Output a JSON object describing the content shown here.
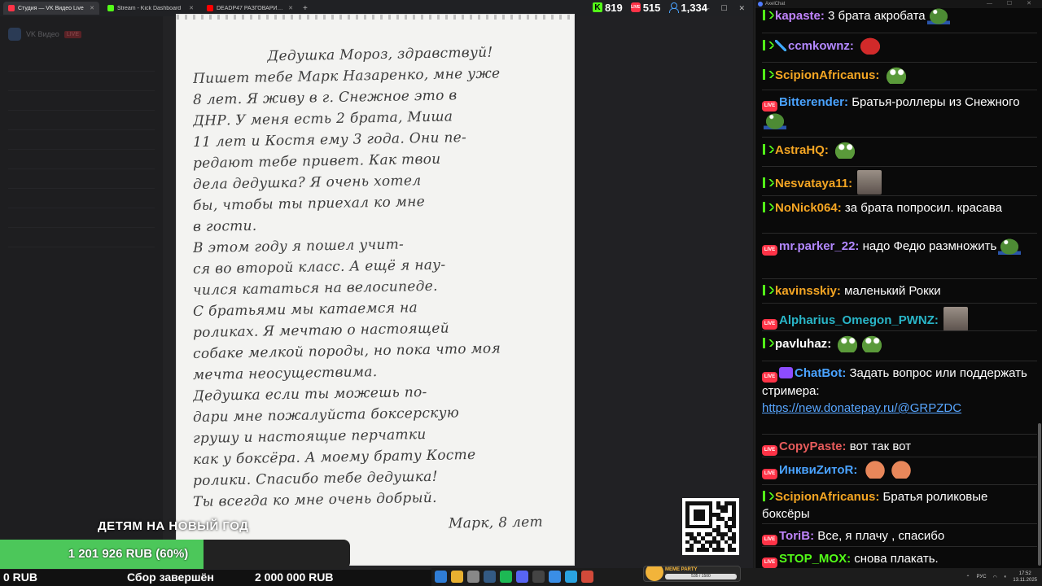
{
  "browser": {
    "tabs": [
      {
        "title": "Студия — VK Видео Live",
        "color": "#ff3347",
        "active": true
      },
      {
        "title": "Stream - Kick Dashboard",
        "color": "#53fc18",
        "active": false
      },
      {
        "title": "DEADP47 РАЗГОВАРИВАЕТ С ...",
        "color": "#ff0000",
        "active": false
      }
    ],
    "new_tab": "+"
  },
  "stats": {
    "kick_viewers": "819",
    "vk_viewers": "515",
    "total_viewers": "1,334"
  },
  "background_page": {
    "logo": "VK Видео",
    "logo_tag": "LIVE"
  },
  "letter": {
    "lines": [
      "Дедушка Мороз, здравствуй!",
      "Пишет тебе Марк Назаренко, мне уже",
      "8 лет. Я живу в г. Снежное это в",
      "ДНР. У меня есть 2 брата, Миша",
      "11 лет и Костя ему 3 года. Они пе-",
      "редают тебе привет. Как твои",
      "дела дедушка? Я очень хотел",
      "бы, чтобы ты приехал ко мне",
      "в гости.",
      "В этом году я пошел учит-",
      "ся во второй класс. А ещё я нау-",
      "чился кататься на велосипеде.",
      "С братьями мы катаемся на",
      "роликах. Я мечтаю о настоящей",
      "собаке мелкой породы, но пока что моя",
      "мечта неосуществима.",
      "Дедушка если ты можешь по-",
      "дари мне пожалуйста боксерскую",
      "грушу и настоящие перчатки",
      "как у боксёра. А моему брату Косте",
      "ролики. Спасибо тебе дедушка!",
      "Ты всегда ко мне очень добрый."
    ],
    "signature": "Марк, 8 лет"
  },
  "donation": {
    "title": "ДЕТЯМ НА НОВЫЙ ГОД",
    "collected": "1 201 926 RUB (60%)",
    "progress": 0.6,
    "min": "0 RUB",
    "status": "Сбор завершён",
    "goal": "2 000 000 RUB",
    "fill_color": "#4cc75a"
  },
  "widget": {
    "label": "MEME PARTY",
    "progress": "535 / 1500"
  },
  "tray": {
    "lang": "РУС",
    "time": "17:52",
    "date": "13.11.2025"
  },
  "chat": {
    "window_title": "AxelChat",
    "messages": [
      {
        "platform": "kick",
        "user": "kapaste",
        "color": "#c084fc",
        "text": "3 брата акробата",
        "emotes": [
          "pepe-skate"
        ]
      },
      {
        "platform": "kick",
        "badge": "sword",
        "user": "ccmkownz",
        "color": "#b388ff",
        "text": "",
        "emotes": [
          "redguy"
        ]
      },
      {
        "platform": "kick",
        "user": "ScipionAfricanus",
        "color": "#f5a623",
        "text": "",
        "emotes": [
          "pepe"
        ]
      },
      {
        "platform": "vk",
        "user": "Bitterender",
        "color": "#4aa3ff",
        "text": "Братья-роллеры из Снежного",
        "emotes": [
          "pepe-skate"
        ]
      },
      {
        "platform": "kick",
        "user": "AstraHQ",
        "color": "#f5a623",
        "text": "",
        "emotes": [
          "pepe"
        ]
      },
      {
        "platform": "kick",
        "user": "Nesvataya11",
        "color": "#f5a623",
        "text": "",
        "emotes": [
          "photo"
        ]
      },
      {
        "platform": "kick",
        "user": "NoNick064",
        "color": "#f5a623",
        "text": "за брата попросил. красава",
        "emotes": []
      },
      {
        "platform": "vk",
        "user": "mr.parker_22",
        "color": "#b388ff",
        "text": "надо Федю размножить",
        "emotes": [
          "pepe-skate"
        ]
      },
      {
        "platform": "kick",
        "user": "kavinsskiy",
        "color": "#f5a623",
        "text": "маленький Рокки",
        "emotes": []
      },
      {
        "platform": "vk",
        "user": "Alpharius_Omegon_PWNZ",
        "color": "#29b6c8",
        "text": "",
        "emotes": [
          "photo"
        ]
      },
      {
        "platform": "kick",
        "user": "pavluhaz",
        "color": "#fff",
        "text": "",
        "emotes": [
          "pepe",
          "pepe"
        ]
      },
      {
        "platform": "vk",
        "badge": "bot",
        "user": "ChatBot",
        "color": "#4aa3ff",
        "text": "Задать вопрос или поддержать стримера:",
        "link": "https://new.donatepay.ru/@GRPZDC",
        "emotes": []
      },
      {
        "platform": "vk",
        "user": "CopyPaste",
        "color": "#e85c5c",
        "text": "вот так вот",
        "emotes": []
      },
      {
        "platform": "vk",
        "user": "ИнквиZитоR",
        "color": "#4aa3ff",
        "text": "",
        "emotes": [
          "hearts",
          "hearts"
        ]
      },
      {
        "platform": "kick",
        "user": "ScipionAfricanus",
        "color": "#f5a623",
        "text": "Братья роликовые боксёры",
        "emotes": []
      },
      {
        "platform": "vk",
        "user": "ToriB",
        "color": "#c084fc",
        "text": "Все, я плачу , спасибо",
        "emotes": []
      },
      {
        "platform": "vk",
        "user": "STOP_MOX",
        "color": "#53fc18",
        "text": "снова плакать.",
        "emotes": []
      }
    ]
  }
}
